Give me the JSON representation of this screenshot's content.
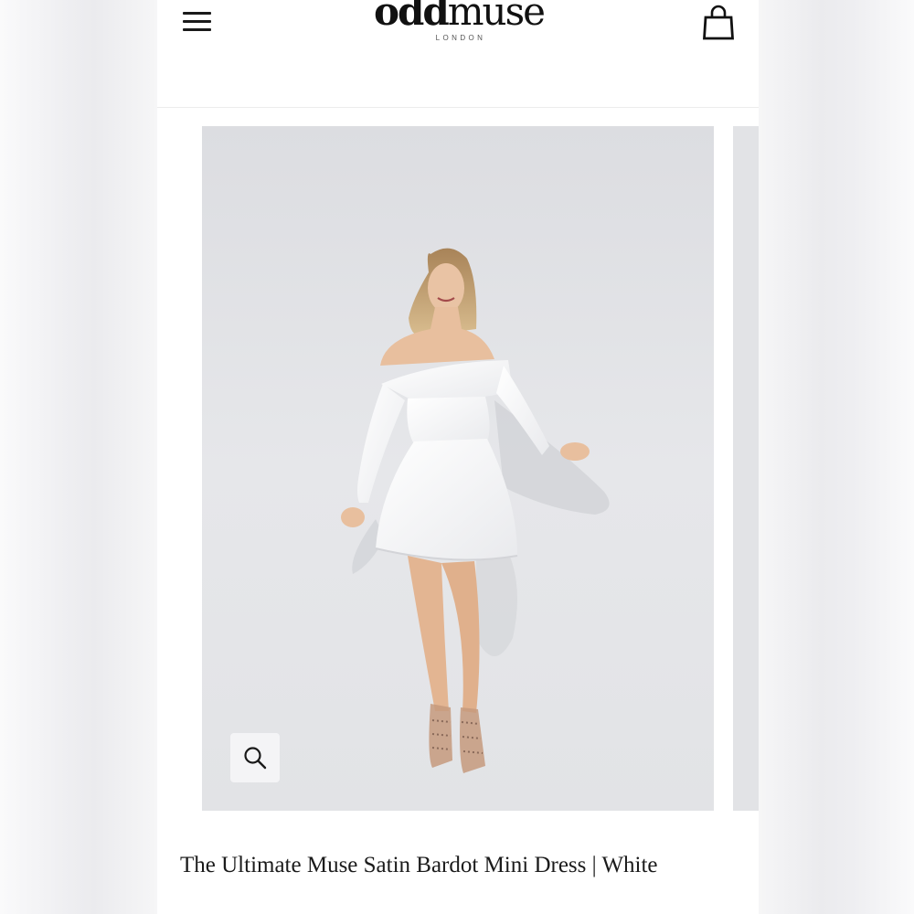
{
  "header": {
    "brand": {
      "name_part1": "odd",
      "name_part2": "muse",
      "location": "LONDON"
    }
  },
  "gallery": {
    "image_alt": "Model wearing white off-shoulder satin mini dress",
    "zoom_icon": "search-icon"
  },
  "product": {
    "title": "The Ultimate Muse Satin Bardot Mini Dress | White"
  },
  "colors": {
    "background": "#ffffff",
    "text": "#1b1b1b",
    "photo_backdrop": "#e4e5e8"
  }
}
